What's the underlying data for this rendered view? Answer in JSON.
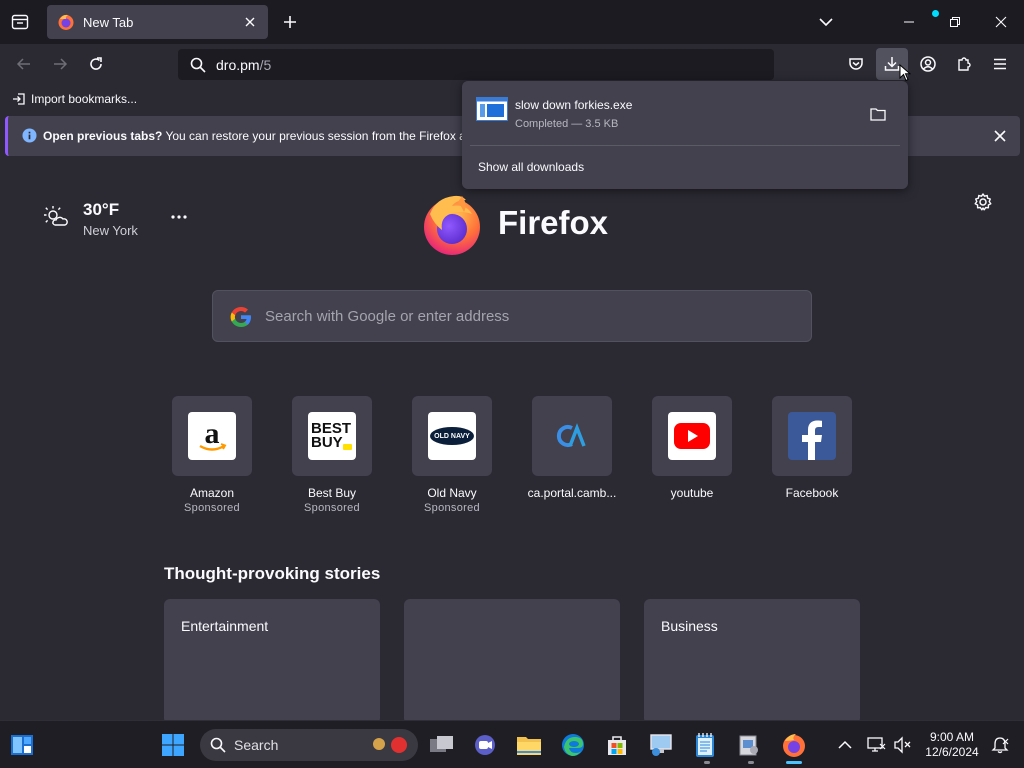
{
  "browser": {
    "tab": {
      "title": "New Tab"
    },
    "url": {
      "host": "dro.pm",
      "path": "/5"
    },
    "bookmarks": {
      "import_label": "Import bookmarks..."
    }
  },
  "notification": {
    "bold": "Open previous tabs?",
    "text": " You can restore your previous session from the Firefox appl"
  },
  "downloads": {
    "file_name": "slow down forkies.exe",
    "status": "Completed — 3.5 KB",
    "show_all": "Show all downloads"
  },
  "weather": {
    "temp": "30°F",
    "city": "New York"
  },
  "brand": {
    "wordmark": "Firefox"
  },
  "search": {
    "placeholder": "Search with Google or enter address"
  },
  "top_sites": [
    {
      "name": "Amazon",
      "sponsored": "Sponsored"
    },
    {
      "name": "Best Buy",
      "sponsored": "Sponsored",
      "logo_text": "BEST BUY"
    },
    {
      "name": "Old Navy",
      "sponsored": "Sponsored",
      "logo_text": "OLD NAVY"
    },
    {
      "name": "ca.portal.camb...",
      "sponsored": ""
    },
    {
      "name": "youtube",
      "sponsored": ""
    },
    {
      "name": "Facebook",
      "sponsored": ""
    }
  ],
  "stories": {
    "title": "Thought-provoking stories",
    "cards": [
      {
        "label": "Entertainment"
      },
      {
        "label": ""
      },
      {
        "label": "Business"
      }
    ]
  },
  "taskbar": {
    "search_label": "Search",
    "time": "9:00 AM",
    "date": "12/6/2024"
  },
  "colors": {
    "accent": "#9059ff",
    "link_blue": "#00ddff",
    "youtube_red": "#ff0000",
    "facebook_blue": "#1877f2"
  }
}
